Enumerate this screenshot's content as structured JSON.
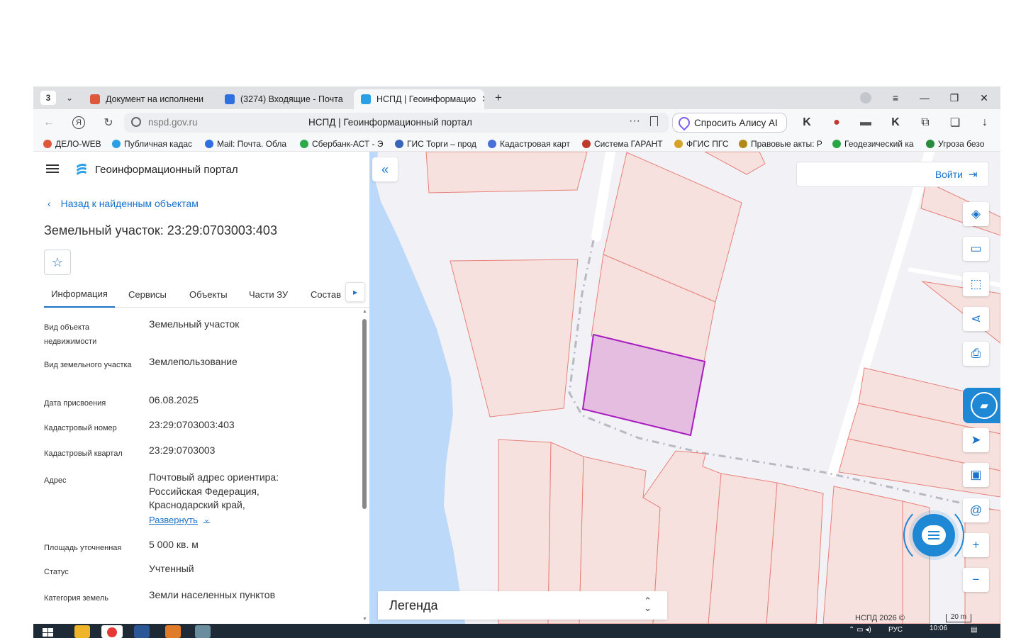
{
  "browser": {
    "tabs": [
      {
        "label": "Документ на исполнени",
        "active": false
      },
      {
        "label": "(3274) Входящие - Почта",
        "active": false
      },
      {
        "label": "НСПД | Геоинформацио",
        "active": true
      }
    ],
    "tab_counter": "3",
    "url": "nspd.gov.ru",
    "page_title": "НСПД | Геоинформационный портал",
    "alice_label": "Спросить Алису AI",
    "bookmarks": [
      "ДЕЛО-WEB",
      "Публичная кадас",
      "Mail: Почта. Обла",
      "Сбербанк-АСТ - Э",
      "ГИС Торги – прод",
      "Кадастровая карт",
      "Система ГАРАНТ",
      "ФГИС ПГС",
      "Правовые акты: Р",
      "Геодезический ка",
      "Угроза безо"
    ]
  },
  "panel": {
    "portal_name": "Геоинформационный портал",
    "back_label": "Назад к найденным объектам",
    "object_title": "Земельный участок: 23:29:0703003:403",
    "tabs": [
      "Информация",
      "Сервисы",
      "Объекты",
      "Части ЗУ",
      "Состав"
    ],
    "active_tab": "Информация",
    "properties": [
      {
        "key": "Вид объекта недвижимости",
        "value": "Земельный участок"
      },
      {
        "key": "Вид земельного участка",
        "value": "Землепользование"
      },
      {
        "key": "Дата присвоения",
        "value": "06.08.2025"
      },
      {
        "key": "Кадастровый номер",
        "value": "23:29:0703003:403"
      },
      {
        "key": "Кадастровый квартал",
        "value": "23:29:0703003"
      },
      {
        "key": "Адрес",
        "value": "Почтовый адрес ориентира: Российская Федерация, Краснодарский край,"
      },
      {
        "key": "Площадь уточненная",
        "value": "5 000 кв. м"
      },
      {
        "key": "Статус",
        "value": "Учтенный"
      },
      {
        "key": "Категория земель",
        "value": "Земли населенных пунктов"
      }
    ],
    "expand_label": "Развернуть"
  },
  "map": {
    "login_label": "Войти",
    "legend_label": "Легенда",
    "copyright": "НСПД 2026 ©",
    "scale_label": "20 m",
    "controls": [
      "layers-icon",
      "ruler-icon",
      "select-area-icon",
      "share-icon",
      "print-icon",
      "navigate-icon",
      "minimap-icon",
      "at-icon",
      "zoom-in-icon",
      "zoom-out-icon"
    ],
    "colors": {
      "parcel_fill": "#f6e1de",
      "parcel_stroke": "#e8817a",
      "selected_fill": "#e5bde0",
      "selected_stroke": "#a81ec0",
      "water": "#bdd9f9",
      "accent": "#1a73c9"
    }
  },
  "taskbar": {
    "lang": "РУС",
    "time": "10:06"
  }
}
